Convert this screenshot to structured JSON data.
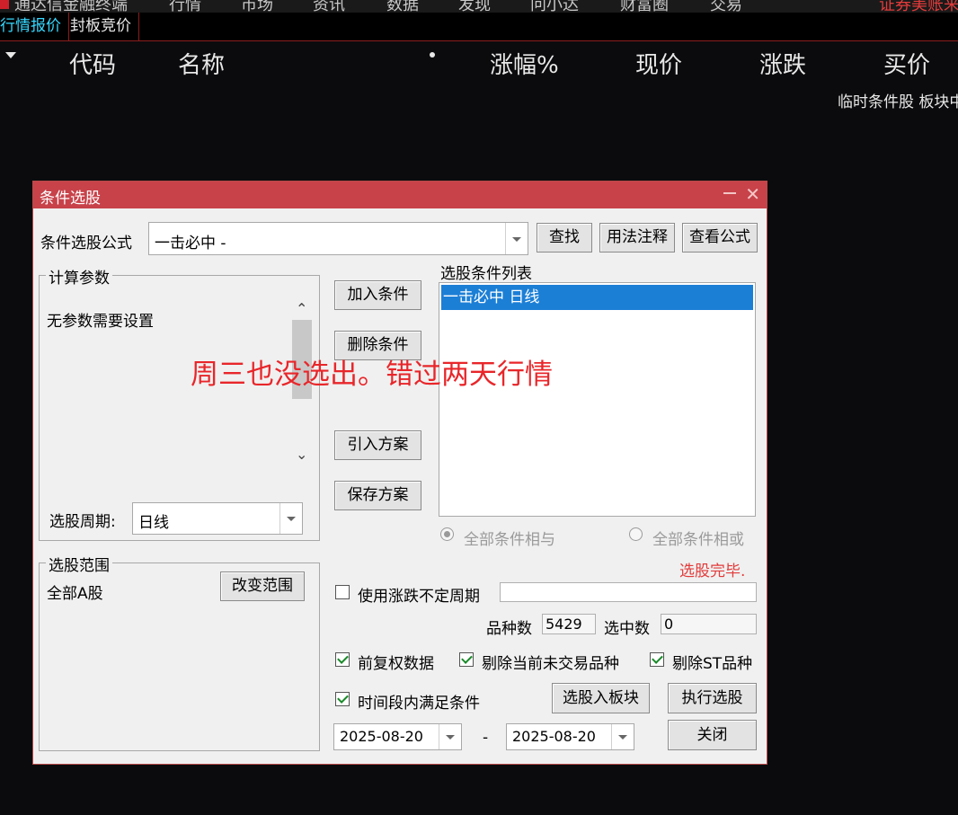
{
  "menubar": {
    "items": [
      "通达信金融终端",
      "行情",
      "市场",
      "资讯",
      "数据",
      "发现",
      "问小达",
      "财富圈",
      "交易"
    ],
    "right_text": "证券美账来"
  },
  "tabs": [
    {
      "label": "行情报价",
      "active": true
    },
    {
      "label": "封板竞价",
      "active": false
    }
  ],
  "table_header": {
    "columns": [
      "代码",
      "名称",
      "涨幅%",
      "现价",
      "涨跌",
      "买价"
    ]
  },
  "status_line": "临时条件股 板块中",
  "dialog": {
    "title": "条件选股",
    "formula_label": "条件选股公式",
    "formula_value": "一击必中  -",
    "find_button": "查找",
    "usage_button": "用法注释",
    "view_formula_button": "查看公式",
    "params_group": "计算参数",
    "params_text": "无参数需要设置",
    "period_label": "选股周期:",
    "period_value": "日线",
    "scope_group": "选股范围",
    "scope_value": "全部A股",
    "change_scope_button": "改变范围",
    "add_condition_button": "加入条件",
    "delete_condition_button": "删除条件",
    "import_plan_button": "引入方案",
    "save_plan_button": "保存方案",
    "condition_list_label": "选股条件列表",
    "condition_items": [
      "一击必中  日线"
    ],
    "radio_and": "全部条件相与",
    "radio_or": "全部条件相或",
    "status": "选股完毕.",
    "indefinite_period_label": "使用涨跌不定周期",
    "indefinite_period_checked": false,
    "count_label": "品种数",
    "count_value": "5429",
    "selected_label": "选中数",
    "selected_value": "0",
    "pre_adjust_label": "前复权数据",
    "pre_adjust_checked": true,
    "exclude_untraded_label": "剔除当前未交易品种",
    "exclude_untraded_checked": true,
    "exclude_st_label": "剔除ST品种",
    "exclude_st_checked": true,
    "period_satisfy_label": "时间段内满足条件",
    "period_satisfy_checked": true,
    "to_block_button": "选股入板块",
    "execute_button": "执行选股",
    "date_from": "2025-08-20",
    "date_sep": "-",
    "date_to": "2025-08-20",
    "close_button": "关闭"
  },
  "annotation": {
    "text": "周三也没选出。错过两天行情",
    "color": "#e8262a"
  },
  "colors": {
    "background": "#0b0b0d",
    "title_bar": "#c8424a",
    "selected_row": "#1c7fd6",
    "active_tab": "#37d8ff"
  }
}
